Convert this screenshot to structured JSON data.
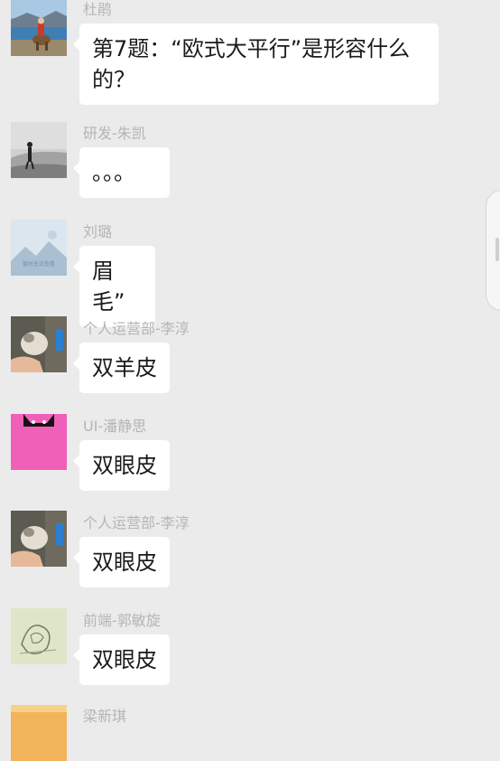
{
  "messages": [
    {
      "sender": "杜鹃",
      "text": "第7题：“欧式大平行”是形容什么的？",
      "avatar": "photo-person-on-horse-lake"
    },
    {
      "sender": "研发-朱凯",
      "text": "。。。",
      "avatar": "photo-person-desert"
    },
    {
      "sender": "刘璐",
      "text": "眉毛”",
      "avatar": "placeholder-image",
      "avatar_caption": "暂时无法查看"
    },
    {
      "sender": "个人运营部-李淳",
      "text": "双羊皮",
      "avatar": "photo-cat-hand"
    },
    {
      "sender": "UI-潘静思",
      "text": "双眼皮",
      "avatar": "pink-with-cat-ears"
    },
    {
      "sender": "个人运营部-李淳",
      "text": "双眼皮",
      "avatar": "photo-cat-hand"
    },
    {
      "sender": "前端-郭敏旋",
      "text": "双眼皮",
      "avatar": "sketch-drawing"
    },
    {
      "sender": "梁新琪",
      "text": "",
      "avatar": "photo-sunset"
    }
  ],
  "colors": {
    "background": "#ebebeb",
    "bubble": "#ffffff",
    "sender_name": "#b5b5b5",
    "text": "#1a1a1a",
    "pink_avatar": "#f060b8"
  }
}
